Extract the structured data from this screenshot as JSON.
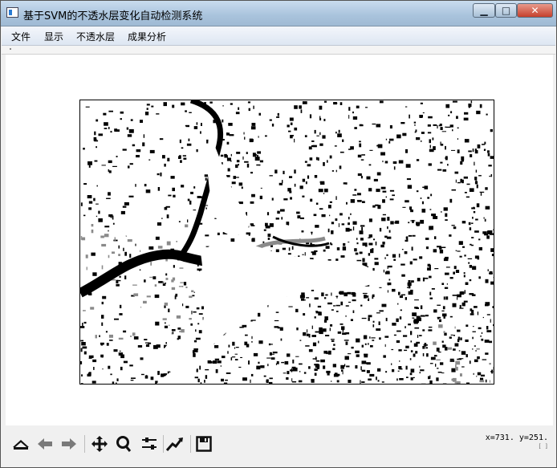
{
  "window": {
    "title": "基于SVM的不透水层变化自动检测系统",
    "minimize_label": "▁",
    "maximize_label": "□",
    "close_label": "✕"
  },
  "menu": {
    "items": [
      {
        "label": "文件"
      },
      {
        "label": "显示"
      },
      {
        "label": "不透水层"
      },
      {
        "label": "成果分析"
      }
    ]
  },
  "figure": {
    "content": "impervious-surface classification raster",
    "colors": {
      "impervious": "#000000",
      "pervious": "#ffffff",
      "water": "#8a8a8a"
    }
  },
  "toolbar": {
    "tools": [
      {
        "name": "home-icon"
      },
      {
        "name": "back-icon"
      },
      {
        "name": "forward-icon"
      },
      {
        "name": "pan-icon"
      },
      {
        "name": "zoom-icon"
      },
      {
        "name": "configure-subplots-icon"
      },
      {
        "name": "edit-axis-icon"
      },
      {
        "name": "save-icon"
      }
    ],
    "coordinates": "x=731. y=251.",
    "coordinates_sub": "[ ]"
  }
}
